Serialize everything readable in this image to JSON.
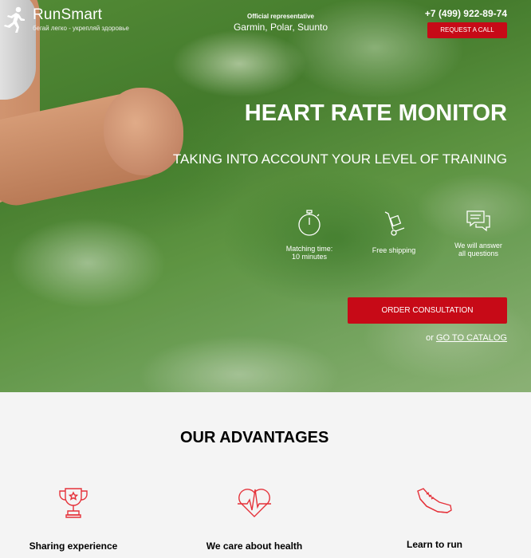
{
  "brand": {
    "name": "RunSmart",
    "tagline": "бегай легко - укрепляй здоровье"
  },
  "representative": {
    "label": "Official representative",
    "brands": "Garmin, Polar, Suunto"
  },
  "contact": {
    "phone": "+7 (499) 922-89-74",
    "call_button": "REQUEST A CALL"
  },
  "hero": {
    "title": "HEART RATE MONITOR",
    "subtitle": "TAKING INTO ACCOUNT YOUR LEVEL OF TRAINING",
    "features": [
      {
        "icon": "stopwatch-icon",
        "text_line1": "Matching time:",
        "text_line2": "10 minutes"
      },
      {
        "icon": "delivery-cart-icon",
        "text_line1": "Free shipping",
        "text_line2": ""
      },
      {
        "icon": "chat-icon",
        "text_line1": "We will answer",
        "text_line2": "all questions"
      }
    ],
    "order_button": "ORDER CONSULTATION",
    "catalog_prefix": "or",
    "catalog_link": "GO TO CATALOG"
  },
  "advantages": {
    "title": "OUR ADVANTAGES",
    "items": [
      {
        "icon": "trophy-icon",
        "label": "Sharing experience"
      },
      {
        "icon": "heart-pulse-icon",
        "label": "We care about health"
      },
      {
        "icon": "running-shoe-icon",
        "label": "Learn to run"
      }
    ]
  },
  "colors": {
    "accent_red": "#c70a17",
    "icon_red": "#e5323a",
    "section_bg": "#f4f4f4"
  }
}
